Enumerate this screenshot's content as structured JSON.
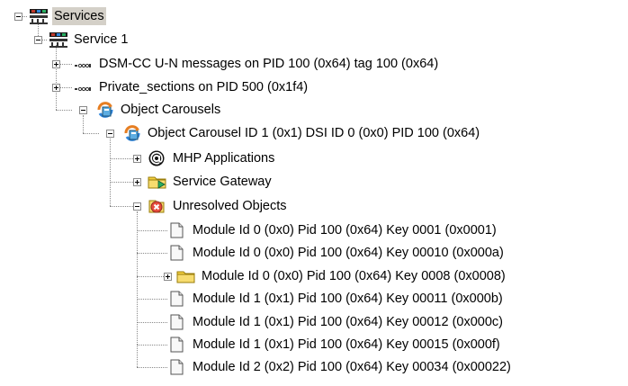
{
  "tree": {
    "root": {
      "label": "Services"
    },
    "service": {
      "label": "Service 1"
    },
    "items": [
      {
        "label": "DSM-CC U-N messages on PID 100 (0x64) tag 100 (0x64)",
        "icon": "stream-icon"
      },
      {
        "label": "Private_sections on PID 500 (0x1f4)",
        "icon": "stream-icon"
      },
      {
        "label": "Object Carousels",
        "icon": "carousel-icon"
      }
    ],
    "carousel": {
      "label": "Object Carousel ID 1 (0x1) DSI ID 0 (0x0) PID 100 (0x64)"
    },
    "carousel_children": [
      {
        "label": "MHP Applications",
        "icon": "mhp-at-icon"
      },
      {
        "label": "Service Gateway",
        "icon": "folder-arrow-icon"
      },
      {
        "label": "Unresolved Objects",
        "icon": "error-icon"
      }
    ],
    "modules": [
      {
        "label": "Module Id 0 (0x0) Pid 100 (0x64) Key 0001 (0x0001)",
        "icon": "file-icon"
      },
      {
        "label": "Module Id 0 (0x0) Pid 100 (0x64) Key 00010 (0x000a)",
        "icon": "file-icon"
      },
      {
        "label": "Module Id 0 (0x0) Pid 100 (0x64) Key 0008 (0x0008)",
        "icon": "folder-icon"
      },
      {
        "label": "Module Id 1 (0x1) Pid 100 (0x64) Key 00011 (0x000b)",
        "icon": "file-icon"
      },
      {
        "label": "Module Id 1 (0x1) Pid 100 (0x64) Key 00012 (0x000c)",
        "icon": "file-icon"
      },
      {
        "label": "Module Id 1 (0x1) Pid 100 (0x64) Key 00015 (0x000f)",
        "icon": "file-icon"
      },
      {
        "label": "Module Id 2 (0x2) Pid 100 (0x64) Key 00034 (0x00022)",
        "icon": "file-icon"
      }
    ]
  }
}
